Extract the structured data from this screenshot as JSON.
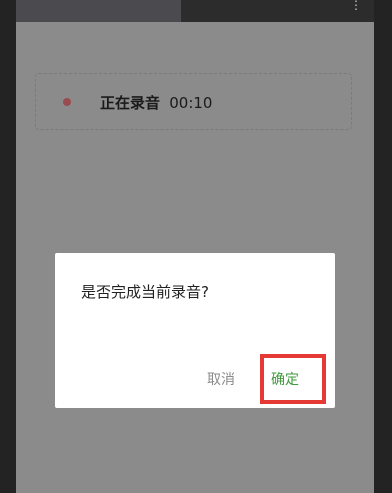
{
  "background_screen": {
    "recording_status": "正在录音",
    "recording_time": "00:10"
  },
  "dialog": {
    "message": "是否完成当前录音?",
    "cancel_label": "取消",
    "confirm_label": "确定"
  },
  "colors": {
    "confirm": "#3f9a3b",
    "cancel": "#8a8a8a",
    "highlight": "#e53935",
    "record_dot": "#9a4b4f"
  },
  "icons": {
    "overflow": "more-vert-icon"
  }
}
